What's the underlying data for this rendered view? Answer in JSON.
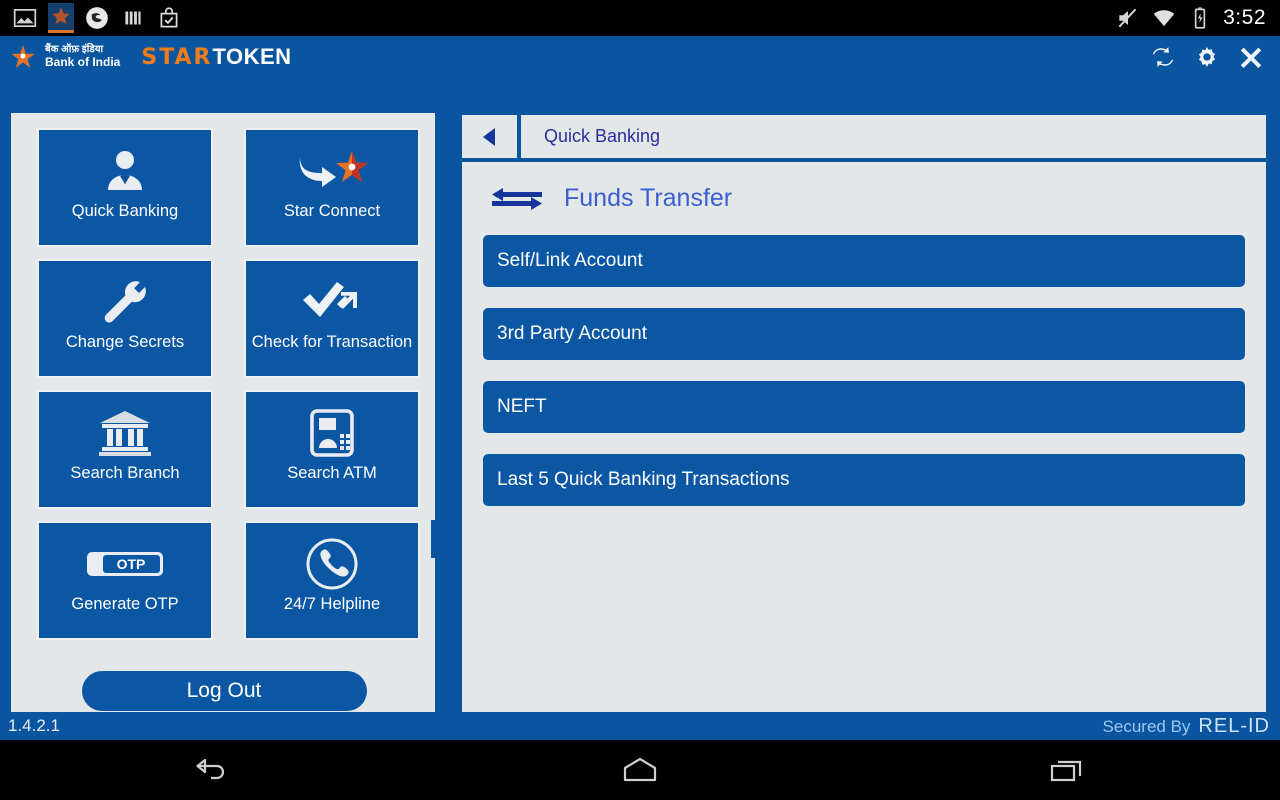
{
  "status_bar": {
    "icons": [
      "gallery-icon",
      "star-token-app-icon",
      "app-icon",
      "bars-icon",
      "checklist-icon"
    ],
    "right_icons": [
      "mute-icon",
      "wifi-icon",
      "battery-charging-icon"
    ],
    "time": "3:52"
  },
  "app_bar": {
    "brand_hindi": "बैंक ऑफ़ इंडिया",
    "brand_en": "Bank of India",
    "product_star": "STAR",
    "product_token": "TOKEN",
    "actions": [
      {
        "name": "sync-icon",
        "label": "Sync"
      },
      {
        "name": "gear-icon",
        "label": "Settings"
      },
      {
        "name": "close-icon",
        "label": "Close"
      }
    ]
  },
  "sidebar": {
    "tiles": [
      {
        "label": "Quick Banking",
        "icon": "user-avatar-icon"
      },
      {
        "label": "Star Connect",
        "icon": "arrow-to-star-icon"
      },
      {
        "label": "Change Secrets",
        "icon": "wrench-icon"
      },
      {
        "label": "Check for Transaction",
        "icon": "check-arrow-icon"
      },
      {
        "label": "Search Branch",
        "icon": "bank-building-icon"
      },
      {
        "label": "Search ATM",
        "icon": "atm-machine-icon"
      },
      {
        "label": "Generate OTP",
        "icon": "otp-toggle-icon"
      },
      {
        "label": "24/7 Helpline",
        "icon": "phone-circle-icon"
      }
    ],
    "logout_label": "Log Out"
  },
  "main": {
    "back_label": "Back",
    "breadcrumb": "Quick Banking",
    "section_title": "Funds Transfer",
    "section_icon": "funds-transfer-arrows-icon",
    "menu_items": [
      {
        "label": "Self/Link Account"
      },
      {
        "label": "3rd Party Account"
      },
      {
        "label": "NEFT"
      },
      {
        "label": "Last 5 Quick Banking Transactions"
      }
    ]
  },
  "footer": {
    "version": "1.4.2.1",
    "secured_by": "Secured By",
    "secured_brand": "REL-ID"
  },
  "nav_bar": {
    "buttons": [
      {
        "name": "android-back-icon",
        "label": "Back"
      },
      {
        "name": "android-home-icon",
        "label": "Home"
      },
      {
        "name": "android-recents-icon",
        "label": "Recents"
      }
    ]
  },
  "colors": {
    "brand_blue": "#0a55a0",
    "tile_blue": "#0b57a4",
    "panel_bg": "#e3e7e8",
    "accent_orange": "#f07d1a",
    "crumb_text": "#2d2d9e",
    "title_blue": "#3b5fd0"
  }
}
